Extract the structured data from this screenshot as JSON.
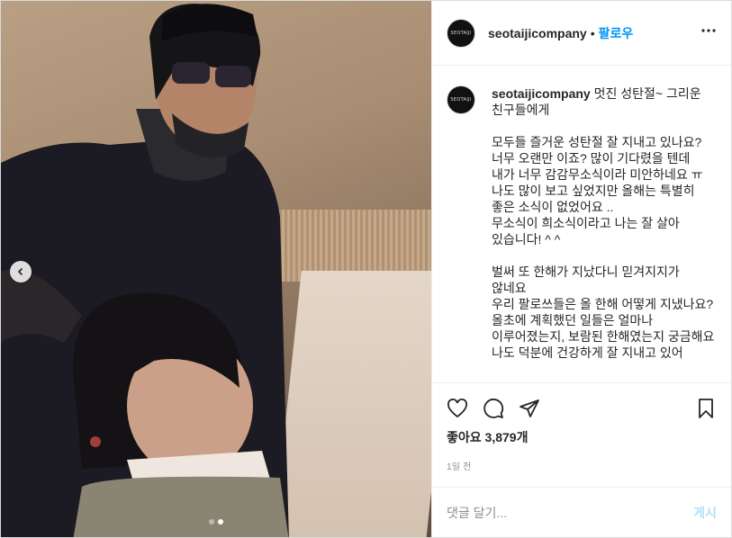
{
  "post": {
    "username": "seotaijicompany",
    "follow_label": "팔로우",
    "separator": "•",
    "avatar_text": "SEOTAIJI"
  },
  "caption": {
    "username": "seotaijicompany",
    "text": "멋진 성탄절~ 그리운 친구들에게\n\n모두들 즐거운 성탄절 잘 지내고 있나요?\n너무 오랜만 이죠? 많이 기다렸을 텐데 내가 너무 감감무소식이라 미안하네요 ㅠ\n나도 많이 보고 싶었지만 올해는 특별히 좋은 소식이 없었어요 ..\n무소식이 희소식이라고 나는 잘 살아 있습니다! ^ ^\n\n벌써 또 한해가 지났다니 믿겨지지가 않네요\n우리 팔로쓰들은 올 한해 어떻게 지냈나요?\n올초에 계획했던 일들은 얼마나 이루어졌는지, 보람된 한해였는지 궁금해요\n나도 덕분에 건강하게 잘 지내고 있어"
  },
  "actions": {
    "likes_text": "좋아요 3,879개",
    "time_text": "1일 전"
  },
  "comment": {
    "placeholder": "댓글 달기...",
    "post_label": "게시"
  },
  "icons": {
    "like": "heart-icon",
    "comment": "comment-icon",
    "share": "share-icon",
    "save": "bookmark-icon",
    "more": "more-icon",
    "prev": "chevron-left-icon"
  },
  "carousel": {
    "total": 2,
    "active": 2
  },
  "colors": {
    "accent": "#0095f6",
    "post_button": "#b2dffc",
    "muted": "#8e8e8e"
  }
}
